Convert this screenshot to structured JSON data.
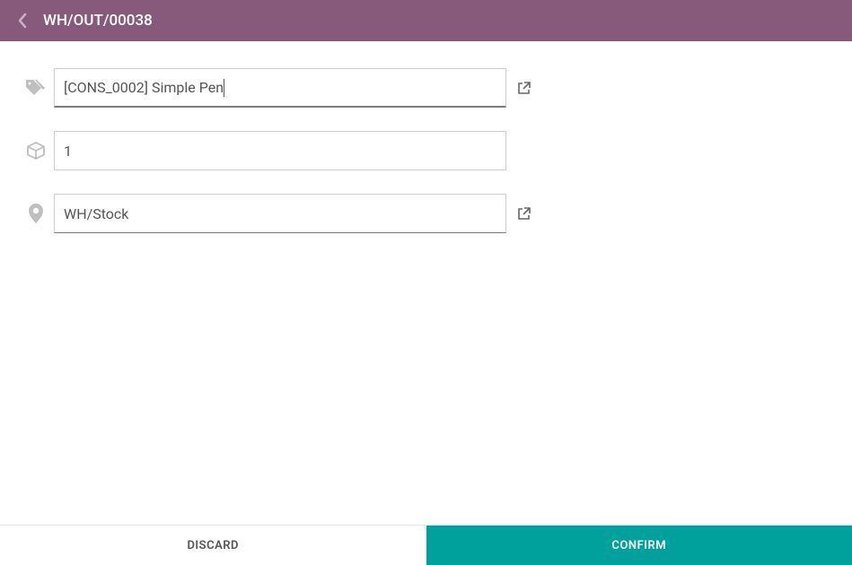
{
  "header": {
    "title": "WH/OUT/00038"
  },
  "form": {
    "product": {
      "value": "[CONS_0002] Simple Pen"
    },
    "quantity": {
      "value": "1"
    },
    "location": {
      "value": "WH/Stock"
    }
  },
  "footer": {
    "discard_label": "Discard",
    "confirm_label": "Confirm"
  }
}
